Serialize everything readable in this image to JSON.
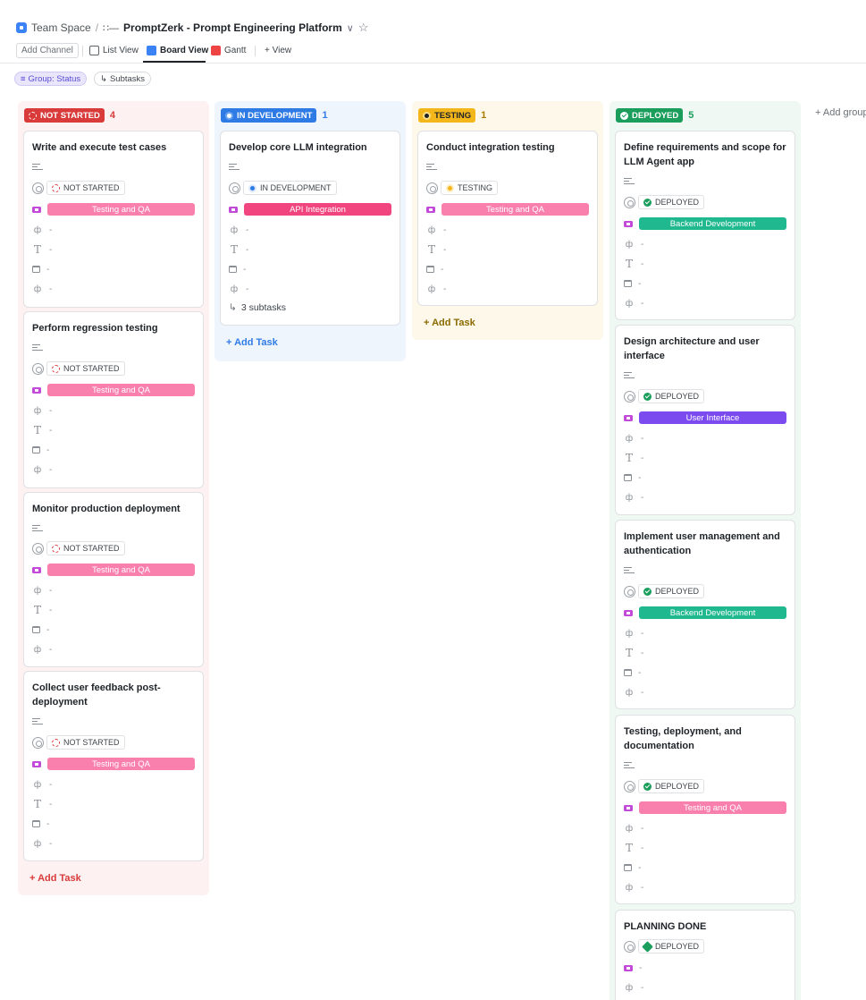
{
  "breadcrumb": {
    "space": "Team Space",
    "separator": "/",
    "list_glyph": "∷—",
    "title": "PromptZerk - Prompt Engineering Platform",
    "chevron": "∨",
    "star": "☆"
  },
  "views": {
    "add_channel": "Add Channel",
    "list": "List View",
    "board": "Board View",
    "gantt": "Gantt",
    "add_view": "+ View"
  },
  "filters": {
    "group": "Group: Status",
    "subtasks": "Subtasks"
  },
  "add_group": "+ Add group",
  "add_task_label": "+ Add Task",
  "dash": "-",
  "columns": {
    "not_started": {
      "label": "NOT STARTED",
      "count": "4",
      "color": "#d93a3a"
    },
    "in_development": {
      "label": "IN DEVELOPMENT",
      "count": "1",
      "color": "#2f7be5"
    },
    "testing": {
      "label": "TESTING",
      "count": "1",
      "color": "#f3b71c"
    },
    "deployed": {
      "label": "DEPLOYED",
      "count": "5",
      "color": "#1b9e5c"
    }
  },
  "tags": {
    "testing_qa": {
      "label": "Testing and QA",
      "color": "#f97fac"
    },
    "api": {
      "label": "API Integration",
      "color": "#f0457f"
    },
    "backend": {
      "label": "Backend Development",
      "color": "#20b88e"
    },
    "ui": {
      "label": "User Interface",
      "color": "#7b4bf0"
    }
  },
  "cards": {
    "ns1": {
      "title": "Write and execute test cases"
    },
    "ns2": {
      "title": "Perform regression testing"
    },
    "ns3": {
      "title": "Monitor production deployment"
    },
    "ns4": {
      "title": "Collect user feedback post-deployment"
    },
    "dev1": {
      "title": "Develop core LLM integration",
      "subtasks": "3 subtasks"
    },
    "test1": {
      "title": "Conduct integration testing"
    },
    "dep1": {
      "title": "Define requirements and scope for LLM Agent app"
    },
    "dep2": {
      "title": "Design architecture and user interface"
    },
    "dep3": {
      "title": "Implement user management and authentication"
    },
    "dep4": {
      "title": "Testing, deployment, and documentation"
    },
    "dep5": {
      "title": "PLANNING DONE"
    }
  },
  "icons": {
    "description": "description-icon",
    "assignee": "assignee-icon",
    "tag": "tag-icon",
    "custom_field": "custom-field-icon",
    "text": "text-field-icon",
    "calendar": "calendar-icon",
    "subtask": "subtask-icon"
  }
}
